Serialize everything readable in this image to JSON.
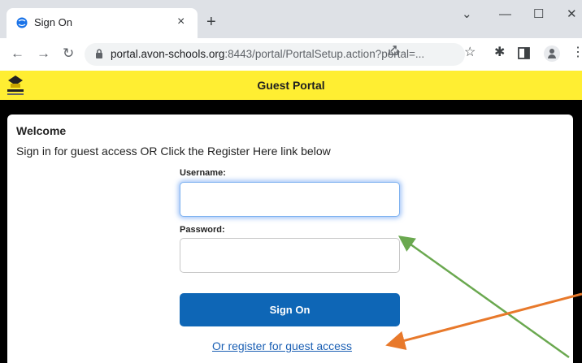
{
  "browser": {
    "tab_title": "Sign On",
    "tab_close": "×",
    "new_tab": "+",
    "min": "—",
    "max": "☐",
    "close": "✕",
    "dropdown": "⌄",
    "url_host": "portal.avon-schools.org",
    "url_rest": ":8443/portal/PortalSetup.action?portal=..."
  },
  "icons": {
    "back": "←",
    "forward": "→",
    "reload": "↻",
    "star": "☆",
    "extensions": "✱",
    "menu": "⋮"
  },
  "portal": {
    "title": "Guest Portal",
    "welcome": "Welcome",
    "instruction": "Sign in for guest access OR Click the Register Here link below",
    "username_label": "Username:",
    "username_value": "",
    "password_label": "Password:",
    "password_value": "",
    "signon_label": "Sign On",
    "register_link": "Or register for guest access"
  },
  "colors": {
    "header_yellow": "#ffee32",
    "button_blue": "#0e66b6",
    "arrow_green": "#6aa84f",
    "arrow_orange": "#e8792b"
  }
}
